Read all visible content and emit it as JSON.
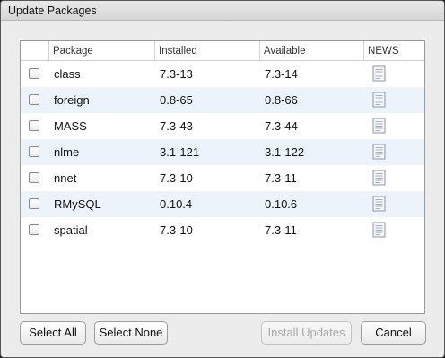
{
  "window": {
    "title": "Update Packages"
  },
  "table": {
    "headers": {
      "package": "Package",
      "installed": "Installed",
      "available": "Available",
      "news": "NEWS"
    },
    "rows": [
      {
        "package": "class",
        "installed": "7.3-13",
        "available": "7.3-14",
        "checked": false
      },
      {
        "package": "foreign",
        "installed": "0.8-65",
        "available": "0.8-66",
        "checked": false
      },
      {
        "package": "MASS",
        "installed": "7.3-43",
        "available": "7.3-44",
        "checked": false
      },
      {
        "package": "nlme",
        "installed": "3.1-121",
        "available": "3.1-122",
        "checked": false
      },
      {
        "package": "nnet",
        "installed": "7.3-10",
        "available": "7.3-11",
        "checked": false
      },
      {
        "package": "RMySQL",
        "installed": "0.10.4",
        "available": "0.10.6",
        "checked": false
      },
      {
        "package": "spatial",
        "installed": "7.3-10",
        "available": "7.3-11",
        "checked": false
      }
    ]
  },
  "buttons": {
    "select_all": "Select All",
    "select_none": "Select None",
    "install_updates": "Install Updates",
    "cancel": "Cancel"
  },
  "icons": {
    "news": "document-icon",
    "checkbox": "checkbox-icon"
  },
  "colors": {
    "alt_row": "#edf3fb",
    "disabled_text": "#a8a8a8"
  }
}
